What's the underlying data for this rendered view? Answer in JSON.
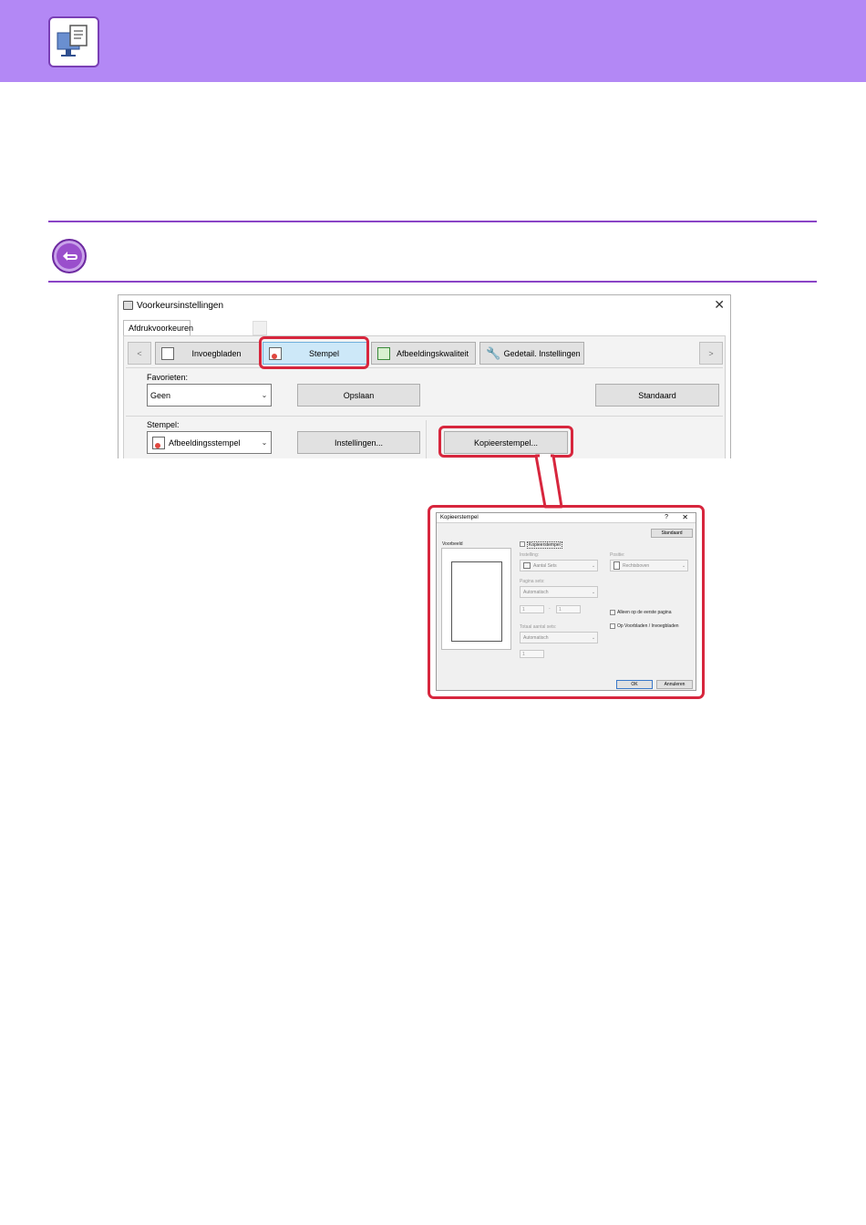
{
  "header": {
    "icon": "pc-print-icon",
    "band_color": "#b388f5"
  },
  "note": {
    "icon": "return-arrow-icon",
    "accent_color": "#8a44c6"
  },
  "dialog": {
    "title": "Voorkeursinstellingen",
    "close_glyph": "✕",
    "tab_label": "Afdrukvoorkeuren",
    "prev_arrow": "<",
    "next_arrow": ">",
    "strip": {
      "invoegbladen": "Invoegbladen",
      "stempel": "Stempel",
      "afbeeldingskwaliteit": "Afbeeldingskwaliteit",
      "gedetail_instellingen": "Gedetail. Instellingen"
    },
    "favorieten_label": "Favorieten:",
    "favorieten_value": "Geen",
    "opslaan": "Opslaan",
    "standaard": "Standaard",
    "stempel_label": "Stempel:",
    "stempel_value": "Afbeeldingsstempel",
    "instellingen": "Instellingen...",
    "kopieerstempel": "Kopieerstempel..."
  },
  "subdialog": {
    "title": "Kopieerstempel",
    "help_glyph": "?",
    "close_glyph": "✕",
    "standaard": "Standaard",
    "voorbeeld": "Voorbeeld",
    "kopieerstempel_check": "Kopieerstempel",
    "instelling_label": "Instelling:",
    "instelling_value": "Aantal Sets",
    "positie_label": "Positie:",
    "positie_value": "Rechtsboven",
    "pagina_sets_label": "Pagina sets:",
    "pagina_sets_value": "Automatisch",
    "range_from": "1",
    "range_sep": "-",
    "range_to": "1",
    "alleen_eerste": "Alleen op de eerste pagina",
    "op_voorbladen": "Op Voorbladen / Invoegbladen",
    "totaal_label": "Totaal aantal sets:",
    "totaal_value": "Automatisch",
    "totaal_input": "1",
    "ok": "OK",
    "annuleren": "Annuleren"
  },
  "colors": {
    "highlight": "#d7263d",
    "active_tab": "#cde8f8"
  }
}
